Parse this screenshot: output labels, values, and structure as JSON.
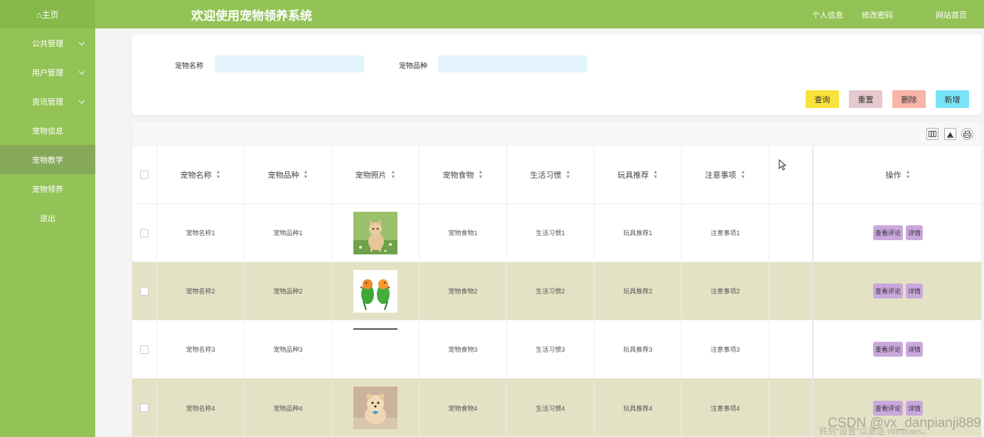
{
  "sidebar": {
    "home": "⌂主页",
    "items": [
      {
        "label": "公共管理",
        "has_chevron": true
      },
      {
        "label": "用户管理",
        "has_chevron": true
      },
      {
        "label": "资讯管理",
        "has_chevron": true
      },
      {
        "label": "宠物信息",
        "has_chevron": false
      },
      {
        "label": "宠物教学",
        "has_chevron": false,
        "active": true
      },
      {
        "label": "宠物领养",
        "has_chevron": false
      },
      {
        "label": "退出",
        "has_chevron": false
      }
    ]
  },
  "header": {
    "title": "欢迎使用宠物领养系统",
    "nav": [
      "个人信息",
      "修改密码",
      "网站首页"
    ]
  },
  "search": {
    "name_label": "宠物名称",
    "name_placeholder": "",
    "breed_label": "宠物品种",
    "breed_placeholder": "",
    "buttons": {
      "query": "查询",
      "reset": "重置",
      "delete": "删除",
      "add": "新增"
    }
  },
  "toolbar": {
    "icons": [
      "columns-icon",
      "export-icon",
      "print-icon"
    ]
  },
  "table": {
    "headers": [
      "宠物名称",
      "宠物品种",
      "宠物照片",
      "宠物食物",
      "生活习惯",
      "玩具推荐",
      "注意事项",
      "",
      "操作"
    ],
    "rows": [
      {
        "name": "宠物名称1",
        "breed": "宠物品种1",
        "photo": "kitten",
        "food": "宠物食物1",
        "habit": "生活习惯1",
        "toy": "玩具推荐1",
        "note": "注意事项1"
      },
      {
        "name": "宠物名称2",
        "breed": "宠物品种2",
        "photo": "parrots",
        "food": "宠物食物2",
        "habit": "生活习惯2",
        "toy": "玩具推荐2",
        "note": "注意事项2"
      },
      {
        "name": "宠物名称3",
        "breed": "宠物品种3",
        "photo": "line",
        "food": "宠物食物3",
        "habit": "生活习惯3",
        "toy": "玩具推荐3",
        "note": "注意事项3"
      },
      {
        "name": "宠物名称4",
        "breed": "宠物品种4",
        "photo": "puppy",
        "food": "宠物食物4",
        "habit": "生活习惯4",
        "toy": "玩具推荐4",
        "note": "注意事项4"
      }
    ],
    "actions": {
      "comments": "查看评论",
      "detail": "详情"
    }
  },
  "watermark": {
    "text": "CSDN @vx_danpianji889",
    "activation": "转到\"设置\"以激活 Windows。"
  },
  "colors": {
    "sidebar": "#93c356",
    "header": "#93c356",
    "alt_row": "#e4e2c4",
    "op_button": "#caa8dc"
  }
}
